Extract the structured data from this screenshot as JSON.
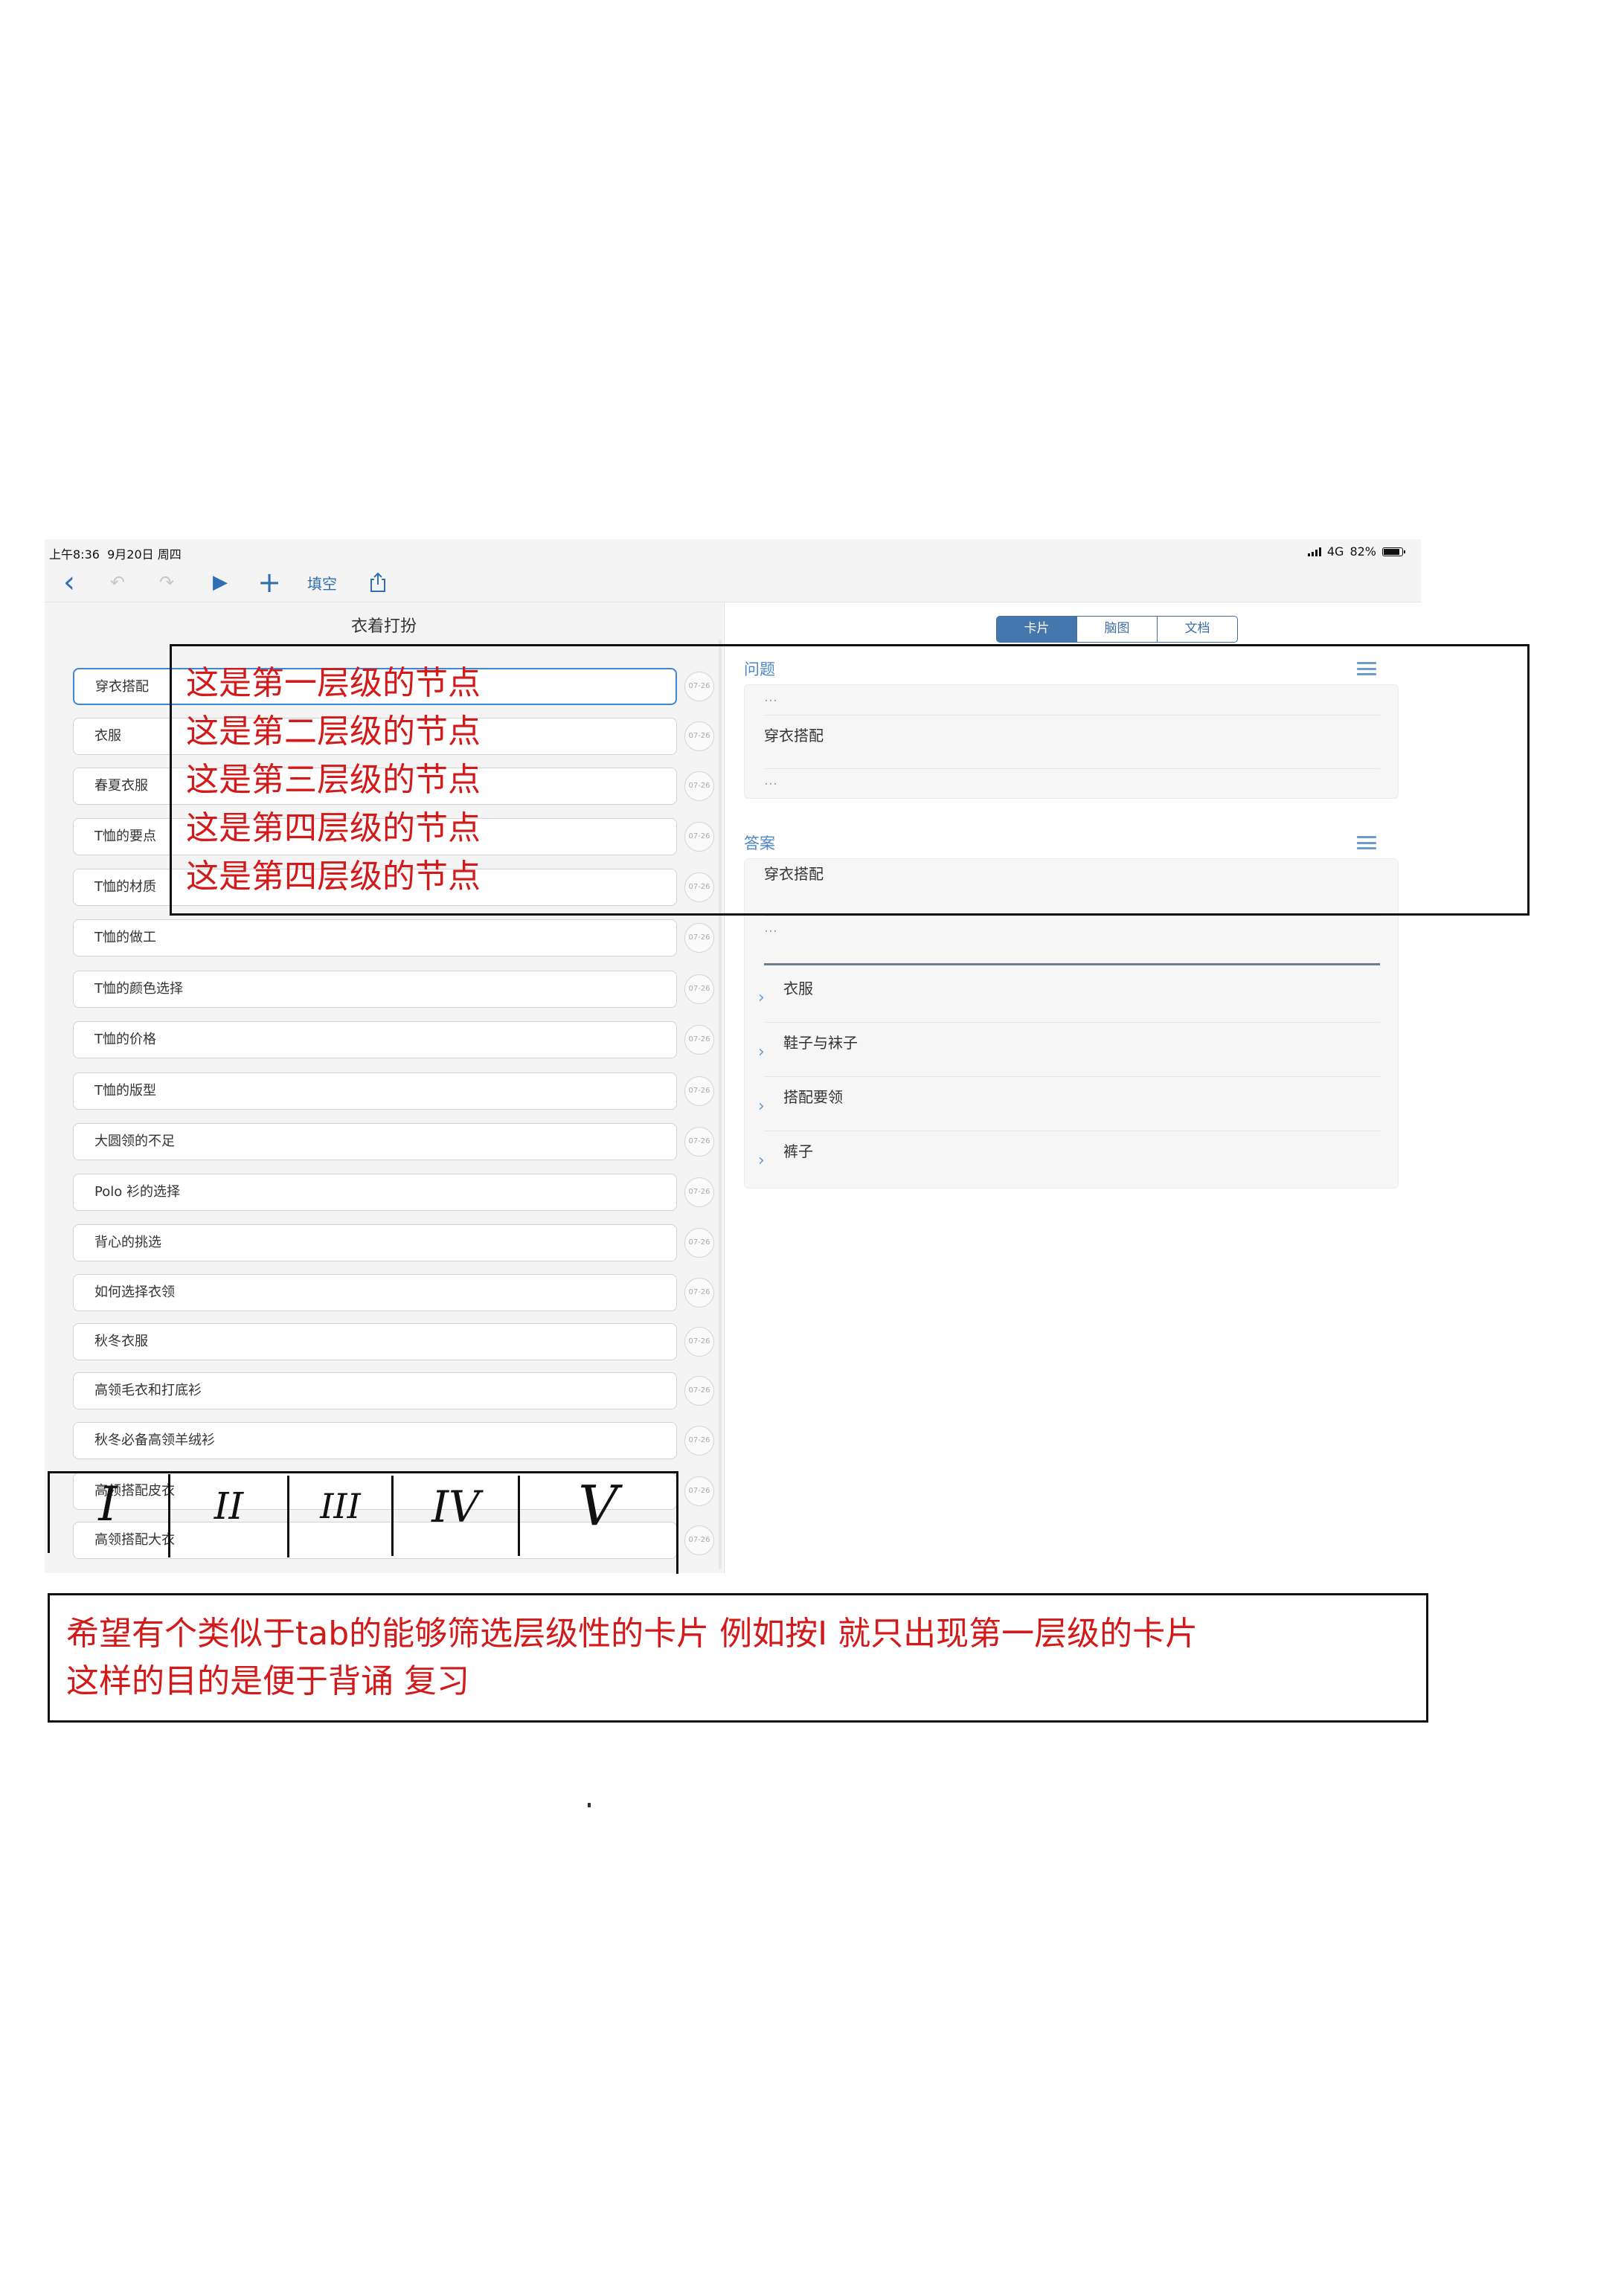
{
  "status": {
    "time": "上午8:36",
    "date": "9月20日 周四",
    "network": "4G",
    "battery": "82%"
  },
  "toolbar": {
    "back": "‹",
    "undo": "↶",
    "redo": "↷",
    "play": "▶",
    "add": "+",
    "fill_label": "填空",
    "share": "share-icon"
  },
  "outline": {
    "title": "衣着打扮",
    "date_badge": "07-26",
    "items": [
      "穿衣搭配",
      "衣服",
      "春夏衣服",
      "T恤的要点",
      "T恤的材质",
      "T恤的做工",
      "T恤的颜色选择",
      "T恤的价格",
      "T恤的版型",
      "大圆领的不足",
      "Polo 衫的选择",
      "背心的挑选",
      "如何选择衣领",
      "秋冬衣服",
      "高领毛衣和打底衫",
      "秋冬必备高领羊绒衫",
      "高领搭配皮衣",
      "高领搭配大衣"
    ]
  },
  "tabs": [
    "卡片",
    "脑图",
    "文档"
  ],
  "question": {
    "title": "问题",
    "dots": "…",
    "text": "穿衣搭配"
  },
  "answer": {
    "title": "答案",
    "text": "穿衣搭配",
    "dots": "…",
    "children": [
      "衣服",
      "鞋子与袜子",
      "搭配要领",
      "裤子"
    ]
  },
  "annotations": {
    "levels": [
      "这是第一层级的节点",
      "这是第二层级的节点",
      "这是第三层级的节点",
      "这是第四层级的节点",
      "这是第四层级的节点"
    ],
    "roman_tabs": [
      "I",
      "II",
      "III",
      "IV",
      "V"
    ],
    "request_line1": "希望有个类似于tab的能够筛选层级性的卡片 例如按I 就只出现第一层级的卡片",
    "request_line2": "这样的目的是便于背诵  复习"
  },
  "colors": {
    "accent": "#3f86d3",
    "annotation_red": "#d21a1a"
  }
}
